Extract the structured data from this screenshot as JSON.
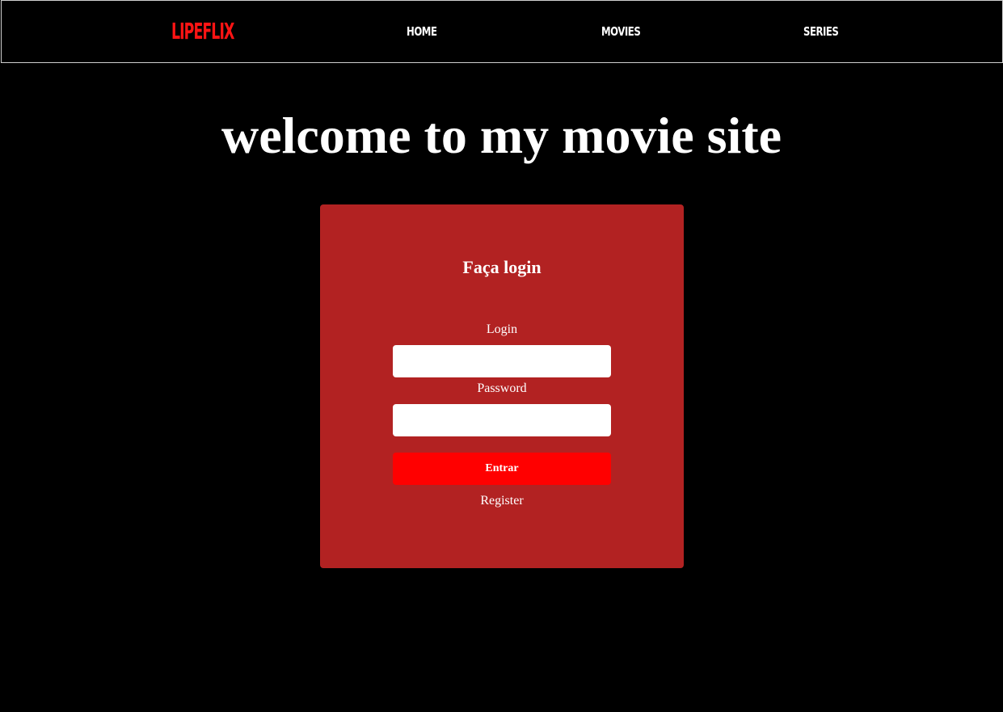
{
  "header": {
    "logo": "LIPEFLIX",
    "nav": {
      "home": "HOME",
      "movies": "MOVIES",
      "series": "SERIES"
    }
  },
  "hero": {
    "title": "welcome to my movie site"
  },
  "login_form": {
    "title": "Faça login",
    "login_label": "Login",
    "login_value": "",
    "password_label": "Password",
    "password_value": "",
    "submit_label": "Entrar",
    "register_label": "Register"
  },
  "colors": {
    "background": "#000000",
    "brand": "#ff1414",
    "card": "#b22222",
    "button": "#ff0000",
    "text": "#ffffff"
  }
}
